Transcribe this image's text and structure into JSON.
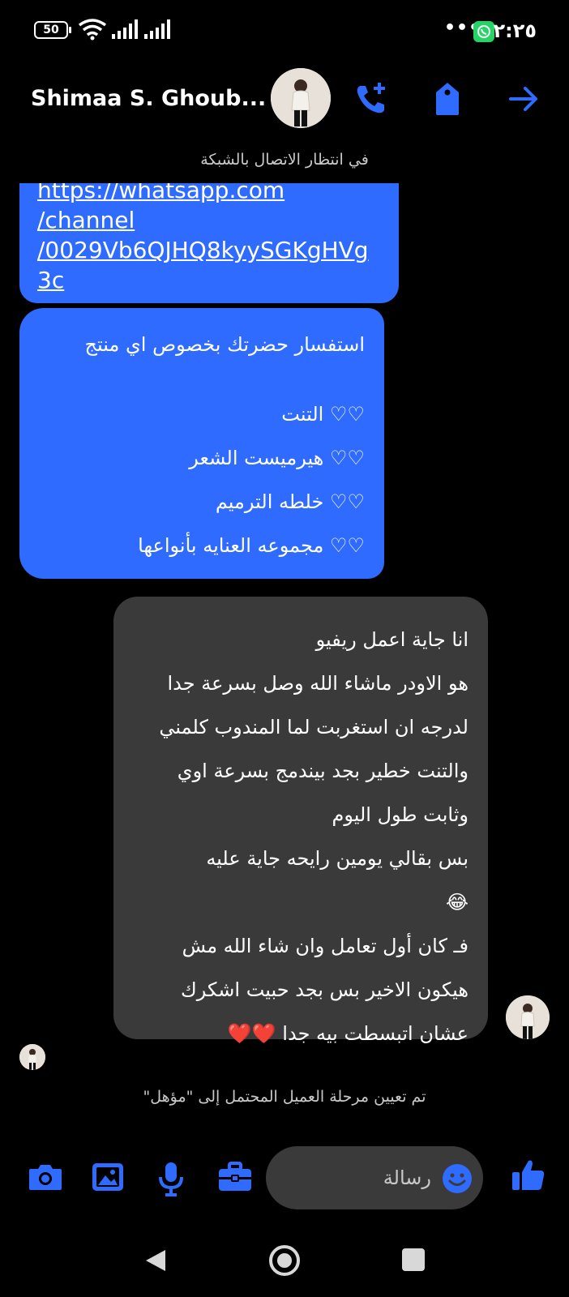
{
  "status_bar": {
    "battery": "50",
    "dots": "•••",
    "time": "٢:٢٥"
  },
  "header": {
    "contact_name": "Shimaa S. Ghoub...",
    "subtitle": "في انتظار الاتصال بالشبكة"
  },
  "messages": {
    "link_lines": [
      "https://whatsapp.com",
      "/channel",
      "/0029Vb6QJHQ8kyySGKgHVg",
      "3c"
    ],
    "product_lines": [
      "استفسار حضرتك بخصوص اي منتج",
      "",
      "♡♡  التنت",
      "♡♡ هيرميست الشعر",
      "♡♡ خلطه الترميم",
      "♡♡ مجموعه العنايه بأنواعها"
    ],
    "reply_lines": [
      "انا جاية اعمل ريفيو",
      "هو الاودر ماشاء الله وصل بسرعة جدا",
      "لدرجه ان استغربت لما المندوب كلمني",
      "والتنت خطير بجد بيندمج بسرعة اوي",
      "وثابت طول اليوم",
      "بس بقالي يومين رايحه جاية عليه",
      "😂",
      "فـ كان أول تعامل وان شاء الله مش",
      "هيكون الاخير بس بجد حبيت اشكرك",
      "عشان اتبسطت بيه جدا ❤️❤️"
    ]
  },
  "system_note": "تم تعيين مرحلة العميل المحتمل إلى \"مؤهل\"",
  "composer": {
    "placeholder": "رسالة"
  },
  "colors": {
    "accent": "#2f6bff",
    "incoming_bubble": "#3a3a3a",
    "background": "#000000"
  }
}
